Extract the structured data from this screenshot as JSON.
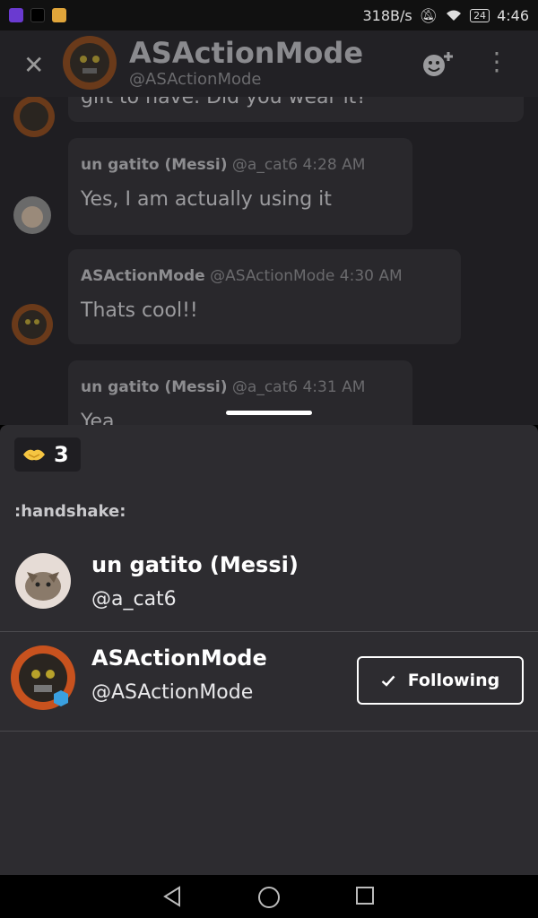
{
  "status_bar": {
    "net_speed": "318B/s",
    "battery": "24",
    "time": "4:46"
  },
  "header": {
    "title": "ASActionMode",
    "handle": "@ASActionMode"
  },
  "messages": [
    {
      "author": "",
      "handle": "",
      "time": "",
      "text": "gift to have. Did you wear it?"
    },
    {
      "author": "un gatito (Messi)",
      "handle": "@a_cat6",
      "time": "4:28 AM",
      "text": "Yes, I am actually using it"
    },
    {
      "author": "ASActionMode",
      "handle": "@ASActionMode",
      "time": "4:30 AM",
      "text": "Thats cool!!"
    },
    {
      "author": "un gatito (Messi)",
      "handle": "@a_cat6",
      "time": "4:31 AM",
      "text": "Yea"
    }
  ],
  "reaction": {
    "emoji_icon": "handshake-icon",
    "count": "3",
    "name": ":handshake:"
  },
  "users": [
    {
      "name": "un gatito (Messi)",
      "handle": "@a_cat6"
    },
    {
      "name": "ASActionMode",
      "handle": "@ASActionMode",
      "button": "Following"
    }
  ],
  "colors": {
    "sheet_bg": "#2d2c30",
    "chat_bg": "#1f1e22",
    "handshake": "#f5c542"
  }
}
